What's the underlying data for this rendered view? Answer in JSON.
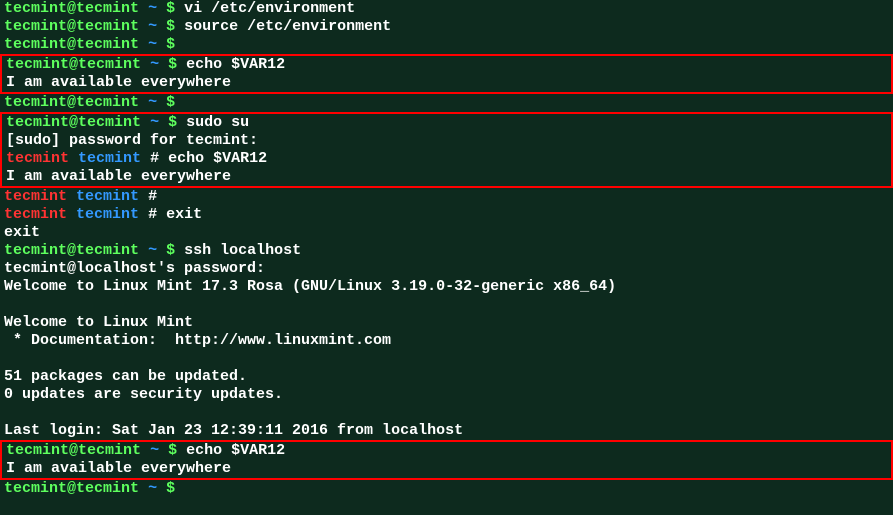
{
  "prompt": {
    "user": "tecmint",
    "host": "tecmint",
    "path": "~",
    "dollar": "$",
    "hash": "#",
    "host_local": "localhost"
  },
  "lines": {
    "l1_cmd": "vi /etc/environment",
    "l2_cmd": "source /etc/environment",
    "l3_cmd": "",
    "l4_cmd": "echo $VAR12",
    "l5_out": "I am available everywhere",
    "l7_cmd": "",
    "l8_cmd": "sudo su",
    "l9_out": "[sudo] password for tecmint:",
    "l10_cmd": "echo $VAR12",
    "l11_out": "I am available everywhere",
    "l13_cmd": "",
    "l14_cmd": "exit",
    "l15_out": "exit",
    "l16_cmd": "ssh localhost",
    "l17_out": "tecmint@localhost's password:",
    "l18_out": "Welcome to Linux Mint 17.3 Rosa (GNU/Linux 3.19.0-32-generic x86_64)",
    "l20_out": "Welcome to Linux Mint",
    "l21_out": " * Documentation:  http://www.linuxmint.com",
    "l23_out": "51 packages can be updated.",
    "l24_out": "0 updates are security updates.",
    "l26_out": "Last login: Sat Jan 23 12:39:11 2016 from localhost",
    "l27_cmd": "echo $VAR12",
    "l28_out": "I am available everywhere",
    "l30_cmd": ""
  }
}
